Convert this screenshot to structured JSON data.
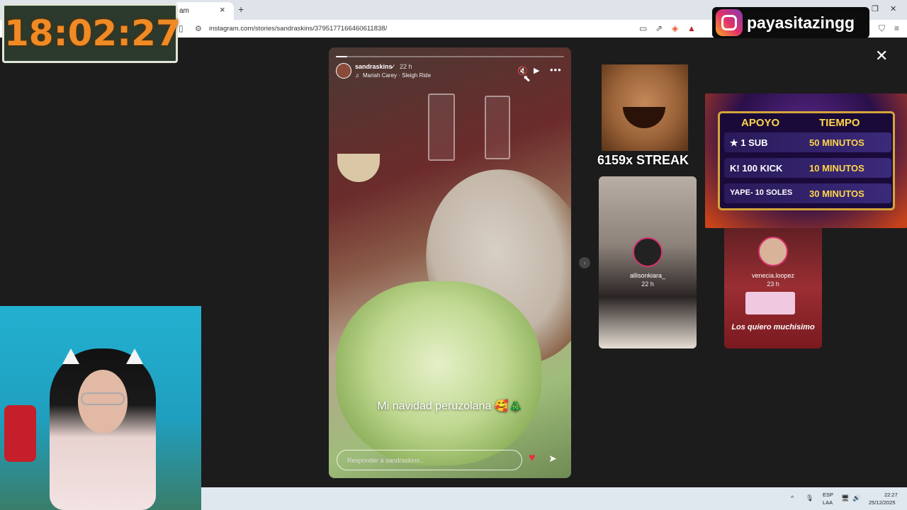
{
  "browser": {
    "tab_title": "am",
    "tab_close": "×",
    "new_tab": "+",
    "url": "instagram.com/stories/sandraskins/3795177166460611838/",
    "window_controls": [
      "—",
      "❐",
      "✕"
    ]
  },
  "overlays": {
    "clock": "18:02:27",
    "instagram_handle": "payasitazingg",
    "streak_text": "6159x STREAK",
    "support_table": {
      "headers": [
        "APOYO",
        "TIEMPO"
      ],
      "rows": [
        {
          "left": "★ 1 SUB",
          "right": "50 MINUTOS"
        },
        {
          "left": "K! 100 KICK",
          "right": "10 MINUTOS"
        },
        {
          "left": "YAPE- 10 SOLES",
          "right": "30 MINUTOS"
        }
      ]
    }
  },
  "story": {
    "username": "sandraskins",
    "verified_icon": "✓",
    "time": "22 h",
    "music_icon": "♫",
    "music": "Mariah Carey · Sleigh Ride",
    "caption": "Mi navidad peruzolana 🥰🎄",
    "reply_placeholder": "Responder a sandraskins...",
    "progress": 0.05,
    "mute_icon": "🔇",
    "play_icon": "▶",
    "more_icon": "•••",
    "heart_icon": "♥",
    "send_icon": "➤"
  },
  "side_stories": [
    {
      "username": "allisonkiara_",
      "time": "22 h"
    },
    {
      "username": "venecia.loopez",
      "time": "23 h",
      "caption": "Los quiero muchisimo"
    }
  ],
  "close_icon": "✕",
  "next_icon": "›",
  "taskbar": {
    "lang_top": "ESP",
    "lang_bottom": "LAA",
    "time": "22:27",
    "date": "25/12/2025",
    "tray_icons": [
      "^",
      "🎙",
      "🖥",
      "🔊"
    ]
  }
}
